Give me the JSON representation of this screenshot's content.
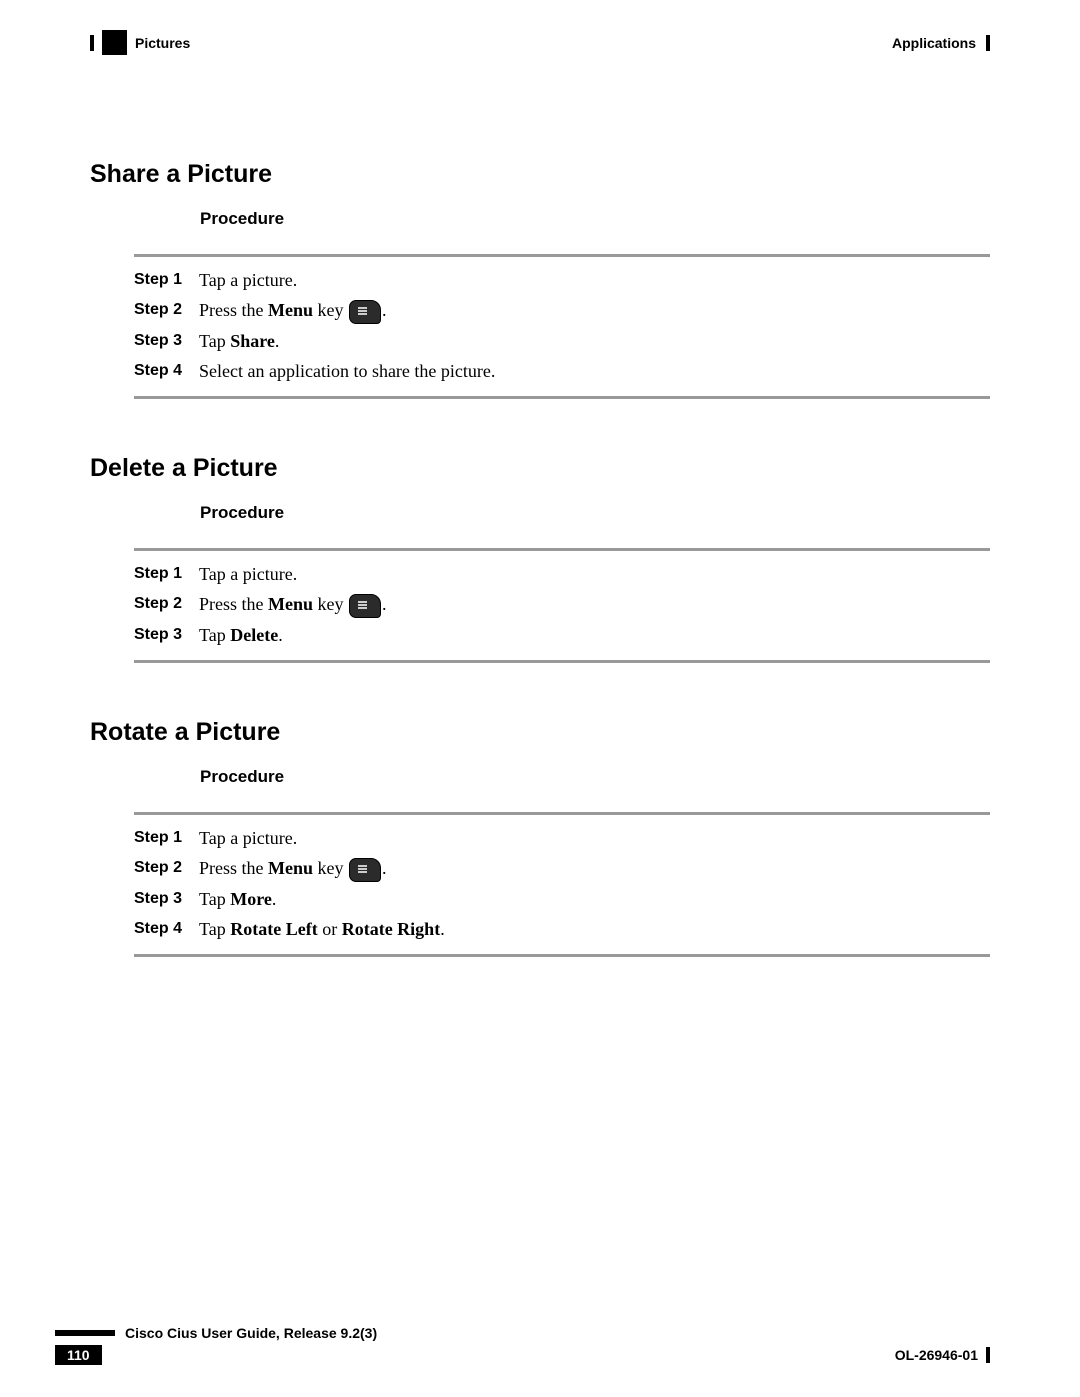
{
  "header": {
    "left_label": "Pictures",
    "right_label": "Applications"
  },
  "sections": [
    {
      "title": "Share a Picture",
      "procedure_label": "Procedure",
      "steps": [
        {
          "label": "Step 1",
          "pre": "Tap a picture."
        },
        {
          "label": "Step 2",
          "pre": "Press the ",
          "bold1": "Menu",
          "mid": " key ",
          "icon": true,
          "post": "."
        },
        {
          "label": "Step 3",
          "pre": "Tap ",
          "bold1": "Share",
          "post": "."
        },
        {
          "label": "Step 4",
          "pre": "Select an application to share the picture."
        }
      ]
    },
    {
      "title": "Delete a Picture",
      "procedure_label": "Procedure",
      "steps": [
        {
          "label": "Step 1",
          "pre": "Tap a picture."
        },
        {
          "label": "Step 2",
          "pre": "Press the ",
          "bold1": "Menu",
          "mid": " key ",
          "icon": true,
          "post": "."
        },
        {
          "label": "Step 3",
          "pre": "Tap ",
          "bold1": "Delete",
          "post": "."
        }
      ]
    },
    {
      "title": "Rotate a Picture",
      "procedure_label": "Procedure",
      "steps": [
        {
          "label": "Step 1",
          "pre": "Tap a picture."
        },
        {
          "label": "Step 2",
          "pre": "Press the ",
          "bold1": "Menu",
          "mid": " key ",
          "icon": true,
          "post": "."
        },
        {
          "label": "Step 3",
          "pre": "Tap ",
          "bold1": "More",
          "post": "."
        },
        {
          "label": "Step 4",
          "pre": "Tap ",
          "bold1": "Rotate Left",
          "mid2": " or ",
          "bold2": "Rotate Right",
          "post": "."
        }
      ]
    }
  ],
  "footer": {
    "guide_title": "Cisco Cius User Guide, Release 9.2(3)",
    "page_number": "110",
    "doc_id": "OL-26946-01"
  }
}
